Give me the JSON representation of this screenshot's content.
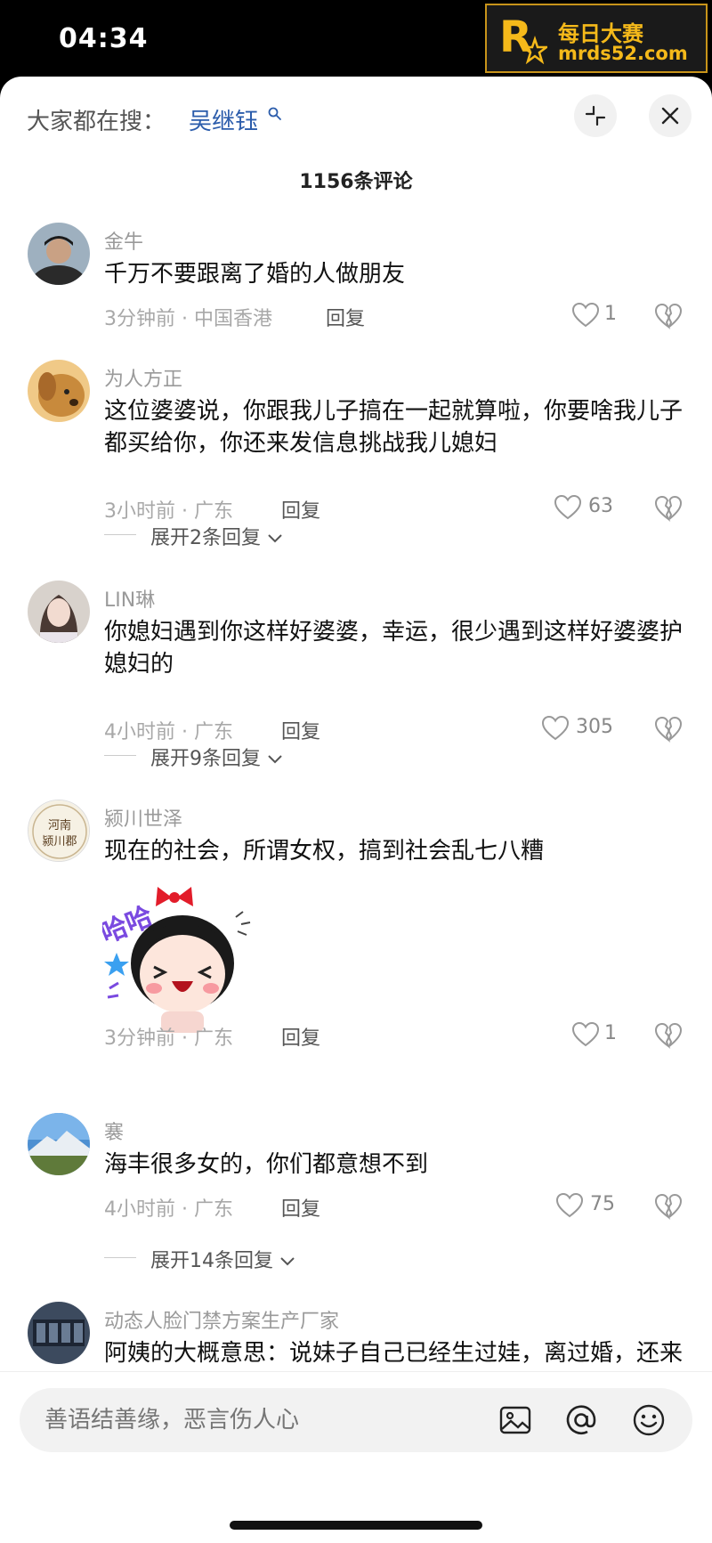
{
  "status_bar": {
    "time": "04:34"
  },
  "watermark": {
    "line1": "每日大赛",
    "line2": "mrds52.com"
  },
  "search_bar": {
    "prefix": "大家都在搜：",
    "keyword": "吴继钰"
  },
  "header": {
    "comment_count": "1156条评论"
  },
  "comments": [
    {
      "username": "金牛",
      "text": "千万不要跟离了婚的人做朋友",
      "time": "3分钟前",
      "location": "中国香港",
      "reply": "回复",
      "likes": "1"
    },
    {
      "username": "为人方正",
      "text": "这位婆婆说，你跟我儿子搞在一起就算啦，你要啥我儿子都买给你，你还来发信息挑战我儿媳妇",
      "time": "3小时前",
      "location": "广东",
      "reply": "回复",
      "likes": "63",
      "expand": "展开2条回复"
    },
    {
      "username": "LIN琳",
      "text": "你媳妇遇到你这样好婆婆，幸运，很少遇到这样好婆婆护媳妇的",
      "time": "4小时前",
      "location": "广东",
      "reply": "回复",
      "likes": "305",
      "expand": "展开9条回复"
    },
    {
      "username": "颍川世泽",
      "text": "现在的社会，所谓女权，搞到社会乱七八糟",
      "sticker_text": "哈哈",
      "avatar_text": "河南颍川郡",
      "time": "3分钟前",
      "location": "广东",
      "reply": "回复",
      "likes": "1"
    },
    {
      "username": "褰",
      "text": "海丰很多女的，你们都意想不到",
      "time": "4小时前",
      "location": "广东",
      "reply": "回复",
      "likes": "75",
      "expand": "展开14条回复"
    },
    {
      "username": "动态人脸门禁方案生产厂家",
      "text": "阿姨的大概意思：说妹子自己已经生过娃，离过婚，还来跟她儿子搞一起，破坏她的家庭，搞他儿"
    }
  ],
  "composer": {
    "placeholder": "善语结善缘，恶言伤人心"
  },
  "colors": {
    "link": "#2b5cab",
    "watermark": "#f5b91a",
    "meta": "#a8a8a8"
  },
  "icons": [
    "search-icon",
    "collapse-icon",
    "close-icon",
    "heart-icon",
    "broken-heart-icon",
    "chevron-down-icon",
    "image-icon",
    "at-icon",
    "emoji-icon"
  ]
}
